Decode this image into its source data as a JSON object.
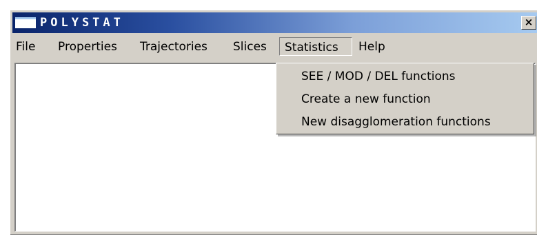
{
  "window": {
    "title": "POLYSTAT",
    "close_label": "×"
  },
  "menubar": {
    "items": [
      {
        "label": "File"
      },
      {
        "label": "Properties"
      },
      {
        "label": "Trajectories"
      },
      {
        "label": "Slices"
      },
      {
        "label": "Statistics",
        "active": true
      },
      {
        "label": "Help"
      }
    ]
  },
  "statistics_menu": {
    "items": [
      {
        "label": "SEE / MOD / DEL functions"
      },
      {
        "label": "Create a new function"
      },
      {
        "label": "New disagglomeration functions"
      }
    ]
  }
}
